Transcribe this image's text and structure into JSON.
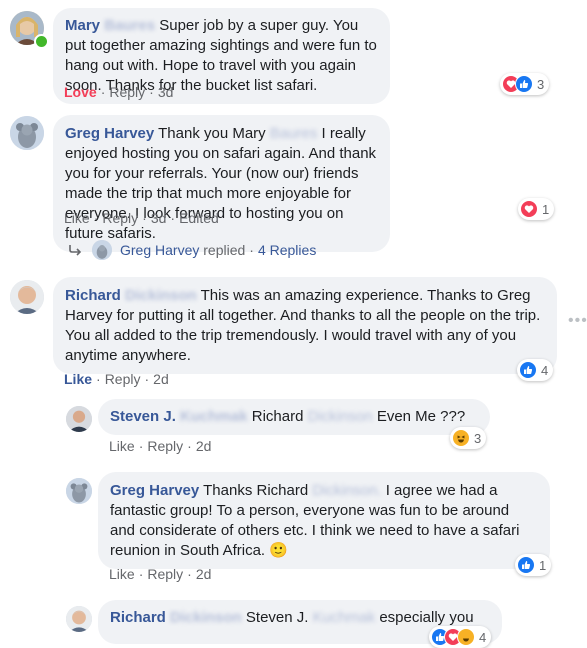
{
  "comments": [
    {
      "author_first": "Mary",
      "author_blurred": "Baures",
      "text": "Super job by a super guy. You put together amazing sightings and were fun to hang out with. Hope to travel with you again soon. Thanks for the bucket list safari.",
      "action_love": "Love",
      "action_reply": "Reply",
      "time": "3d",
      "reactions": [
        "heart",
        "like"
      ],
      "reaction_count": "3"
    },
    {
      "author": "Greg Harvey",
      "text_pre": "Thank you Mary",
      "text_blurred": "Baures",
      "text_post": "I really enjoyed hosting you on safari again. And thank you for your referrals. Your (now our) friends made the trip that much more enjoyable for everyone. I look forward to hosting you on future safaris.",
      "action_like": "Like",
      "action_reply": "Reply",
      "time": "3d",
      "edited": "Edited",
      "reactions": [
        "heart"
      ],
      "reaction_count": "1",
      "replies_summary": {
        "author": "Greg Harvey",
        "verb": "replied",
        "count": "4 Replies"
      }
    },
    {
      "author_first": "Richard",
      "author_blurred": "Dickinson",
      "text": "This was an amazing experience. Thanks to Greg Harvey for putting it all together. And thanks to all the people on the trip. You all added to the trip tremendously. I would travel with any of you anytime anywhere.",
      "action_like": "Like",
      "action_reply": "Reply",
      "time": "2d",
      "reactions": [
        "like"
      ],
      "reaction_count": "4",
      "more_icon": "more-horizontal-icon"
    }
  ],
  "replies": [
    {
      "author_first": "Steven J.",
      "author_blurred": "Kuchmak",
      "text_pre": "Richard",
      "text_blurred": "Dickinson",
      "text_post": "Even Me ???",
      "action_like": "Like",
      "action_reply": "Reply",
      "time": "2d",
      "reactions": [
        "haha"
      ],
      "reaction_count": "3"
    },
    {
      "author": "Greg Harvey",
      "text_pre": "Thanks Richard",
      "text_blurred": "Dickinson.",
      "text_post": "I agree we had a fantastic group! To a person, everyone was fun to be around and considerate of others etc. I think we need to have a safari reunion in South Africa.",
      "emoji": "🙂",
      "action_like": "Like",
      "action_reply": "Reply",
      "time": "2d",
      "reactions": [
        "like"
      ],
      "reaction_count": "1"
    },
    {
      "author_first": "Richard",
      "author_blurred": "Dickinson",
      "text_pre": "Steven J.",
      "text_blurred": "Kuchmak",
      "text_post": "especially you",
      "reactions": [
        "like",
        "heart",
        "haha"
      ],
      "reaction_count": "4"
    }
  ],
  "colors": {
    "link": "#385898",
    "love": "#f33e58",
    "like": "#1877f2",
    "bubble": "#f0f2f5",
    "online": "#42b72a"
  }
}
